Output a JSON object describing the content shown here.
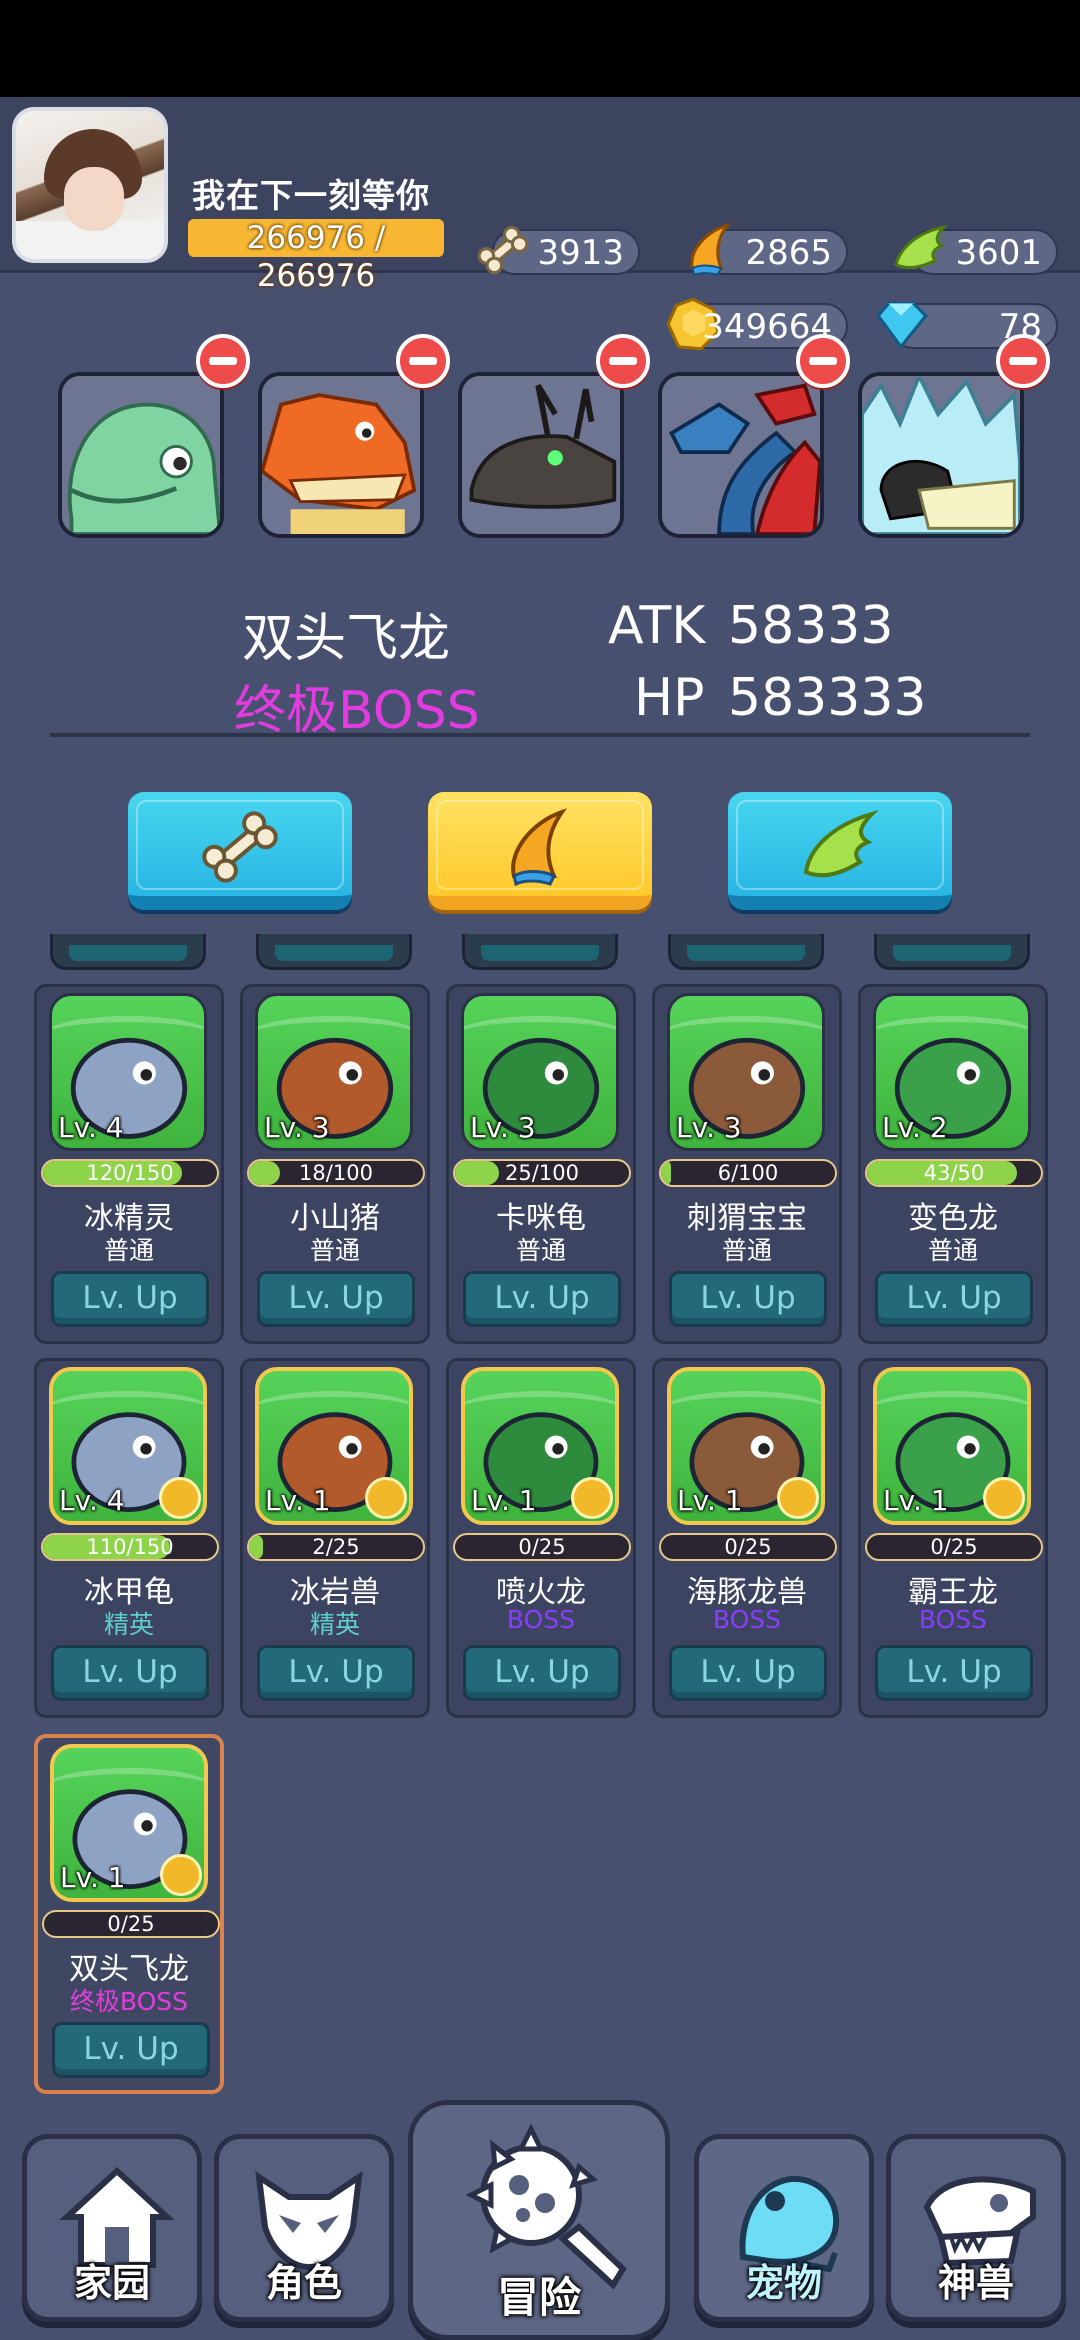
{
  "player": {
    "name": "我在下一刻等你",
    "hp": "266976 / 266976"
  },
  "resources": [
    {
      "icon": "bone-icon",
      "value": "3913"
    },
    {
      "icon": "claw-icon",
      "value": "2865"
    },
    {
      "icon": "wing-icon",
      "value": "3601"
    },
    {
      "icon": "gold-coin-icon",
      "value": "349664"
    },
    {
      "icon": "diamond-icon",
      "value": "78"
    }
  ],
  "team": [
    "海豚龙兽",
    "霸王龙",
    "喷火龙",
    "双头飞龙",
    "冰甲龟"
  ],
  "selected": {
    "name": "双头飞龙",
    "rank": "终极BOSS",
    "atk_label": "ATK",
    "atk": "58333",
    "hp_label": "HP",
    "hp": "583333"
  },
  "feed_buttons": [
    "bone-icon",
    "claw-icon",
    "wing-icon"
  ],
  "pets_row1": [
    {
      "name": "冰精灵",
      "rank": "普通",
      "level": "Lv. 4",
      "xp": "120/150",
      "progress": 0.8,
      "color": "#ffffff"
    },
    {
      "name": "小山猪",
      "rank": "普通",
      "level": "Lv. 3",
      "xp": "18/100",
      "progress": 0.18,
      "color": "#ffffff"
    },
    {
      "name": "卡咪龟",
      "rank": "普通",
      "level": "Lv. 3",
      "xp": "25/100",
      "progress": 0.25,
      "color": "#ffffff"
    },
    {
      "name": "刺猬宝宝",
      "rank": "普通",
      "level": "Lv. 3",
      "xp": "6/100",
      "progress": 0.06,
      "color": "#ffffff"
    },
    {
      "name": "变色龙",
      "rank": "普通",
      "level": "Lv. 2",
      "xp": "43/50",
      "progress": 0.86,
      "color": "#ffffff"
    }
  ],
  "pets_row2": [
    {
      "name": "冰甲龟",
      "rank": "精英",
      "level": "Lv. 4",
      "xp": "110/150",
      "progress": 0.73,
      "color": "#5fd0c8"
    },
    {
      "name": "冰岩兽",
      "rank": "精英",
      "level": "Lv. 1",
      "xp": "2/25",
      "progress": 0.08,
      "color": "#5fd0c8"
    },
    {
      "name": "喷火龙",
      "rank": "BOSS",
      "level": "Lv. 1",
      "xp": "0/25",
      "progress": 0,
      "color": "#8a3cff"
    },
    {
      "name": "海豚龙兽",
      "rank": "BOSS",
      "level": "Lv. 1",
      "xp": "0/25",
      "progress": 0,
      "color": "#8a3cff"
    },
    {
      "name": "霸王龙",
      "rank": "BOSS",
      "level": "Lv. 1",
      "xp": "0/25",
      "progress": 0,
      "color": "#8a3cff"
    }
  ],
  "pets_row3": [
    {
      "name": "双头飞龙",
      "rank": "终极BOSS",
      "level": "Lv. 1",
      "xp": "0/25",
      "progress": 0,
      "color": "#e23ce0"
    }
  ],
  "lvup_label": "Lv. Up",
  "nav": [
    {
      "label": "家园",
      "icon": "home-icon"
    },
    {
      "label": "角色",
      "icon": "mask-icon"
    },
    {
      "label": "冒险",
      "icon": "spiked-mace-icon"
    },
    {
      "label": "宠物",
      "icon": "frog-icon"
    },
    {
      "label": "神兽",
      "icon": "dino-skull-icon"
    }
  ]
}
